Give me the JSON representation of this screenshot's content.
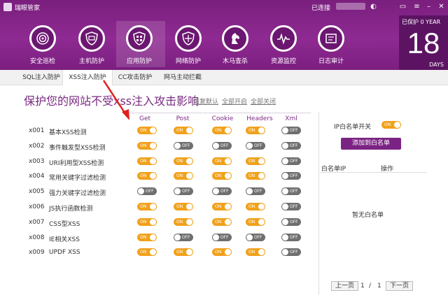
{
  "app": {
    "title": "瑞眼管家",
    "status": "已连接"
  },
  "toolbar": [
    {
      "label": "安全巡检",
      "icon": "radar-icon"
    },
    {
      "label": "主机防护",
      "icon": "shield-icon"
    },
    {
      "label": "应用防护",
      "icon": "building-shield-icon"
    },
    {
      "label": "网络防护",
      "icon": "network-shield-icon"
    },
    {
      "label": "木马查杀",
      "icon": "horse-icon"
    },
    {
      "label": "资源监控",
      "icon": "pulse-icon"
    },
    {
      "label": "日志审计",
      "icon": "log-icon"
    }
  ],
  "protection": {
    "label": "已保护",
    "zero_year": "0 YEAR",
    "days": "18",
    "unit": "DAYS"
  },
  "subtabs": [
    "SQL注入防护",
    "XSS注入防护",
    "CC攻击防护",
    "网马主动拦截"
  ],
  "headline": "保护您的网站不受xss注入攻击影响",
  "links": {
    "restore": "恢复默认",
    "enable_all": "全部开启",
    "disable_all": "全部关闭"
  },
  "columns": [
    "Get",
    "Post",
    "Cookie",
    "Headers",
    "Xml"
  ],
  "rows": [
    {
      "id": "x001",
      "name": "基本XSS检测",
      "toggles": [
        "ON",
        "ON",
        "ON",
        "ON",
        "OFF"
      ]
    },
    {
      "id": "x002",
      "name": "事件触发型XSS检测",
      "toggles": [
        "ON",
        "OFF",
        "OFF",
        "OFF",
        "OFF"
      ]
    },
    {
      "id": "x003",
      "name": "URI利用型XSS检测",
      "toggles": [
        "ON",
        "ON",
        "ON",
        "ON",
        "OFF"
      ]
    },
    {
      "id": "x004",
      "name": "常用关键字过滤检测",
      "toggles": [
        "ON",
        "ON",
        "ON",
        "ON",
        "OFF"
      ]
    },
    {
      "id": "x005",
      "name": "强力关键字过滤检测",
      "toggles": [
        "OFF",
        "OFF",
        "OFF",
        "OFF",
        "OFF"
      ]
    },
    {
      "id": "x006",
      "name": "JS执行函数检测",
      "toggles": [
        "ON",
        "ON",
        "ON",
        "ON",
        "OFF"
      ]
    },
    {
      "id": "x007",
      "name": "CSS型XSS",
      "toggles": [
        "ON",
        "ON",
        "ON",
        "ON",
        "OFF"
      ]
    },
    {
      "id": "x008",
      "name": "IE相关XSS",
      "toggles": [
        "ON",
        "OFF",
        "OFF",
        "OFF",
        "OFF"
      ]
    },
    {
      "id": "x009",
      "name": "UPDF XSS",
      "toggles": [
        "ON",
        "ON",
        "ON",
        "ON",
        "OFF"
      ]
    }
  ],
  "whitelist": {
    "switch_label": "IP白名单开关",
    "switch_state": "ON",
    "add_button": "添加到白名单",
    "col_ip": "白名单IP",
    "col_action": "操作",
    "empty": "暂无白名单",
    "prev": "上一页",
    "page": "1",
    "sep": "/",
    "total": "1",
    "next": "下一页"
  },
  "colors": {
    "accent": "#7a2a82",
    "on": "#f1a11a",
    "off": "#6f6f6f",
    "arrow": "#e02020"
  }
}
